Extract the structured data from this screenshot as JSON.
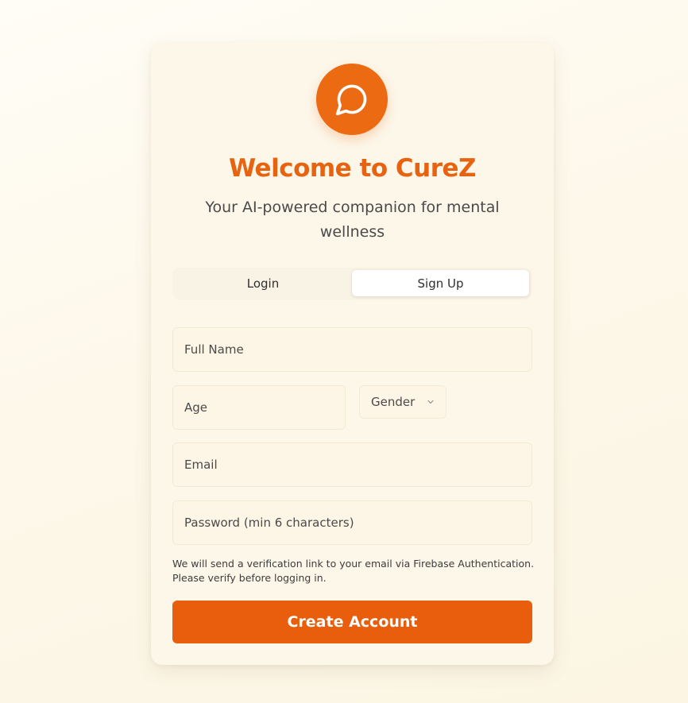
{
  "brand": {
    "icon": "message-circle-icon",
    "accent_color": "#e8630f"
  },
  "header": {
    "title": "Welcome to CureZ",
    "subtitle": "Your AI-powered companion for mental wellness"
  },
  "tabs": [
    {
      "label": "Login",
      "active": false
    },
    {
      "label": "Sign Up",
      "active": true
    }
  ],
  "form": {
    "full_name_placeholder": "Full Name",
    "age_placeholder": "Age",
    "gender_selected": "Gender",
    "email_placeholder": "Email",
    "password_placeholder": "Password (min 6 characters)",
    "note": "We will send a verification link to your email via Firebase Authentication. Please verify before logging in.",
    "submit_label": "Create Account"
  }
}
